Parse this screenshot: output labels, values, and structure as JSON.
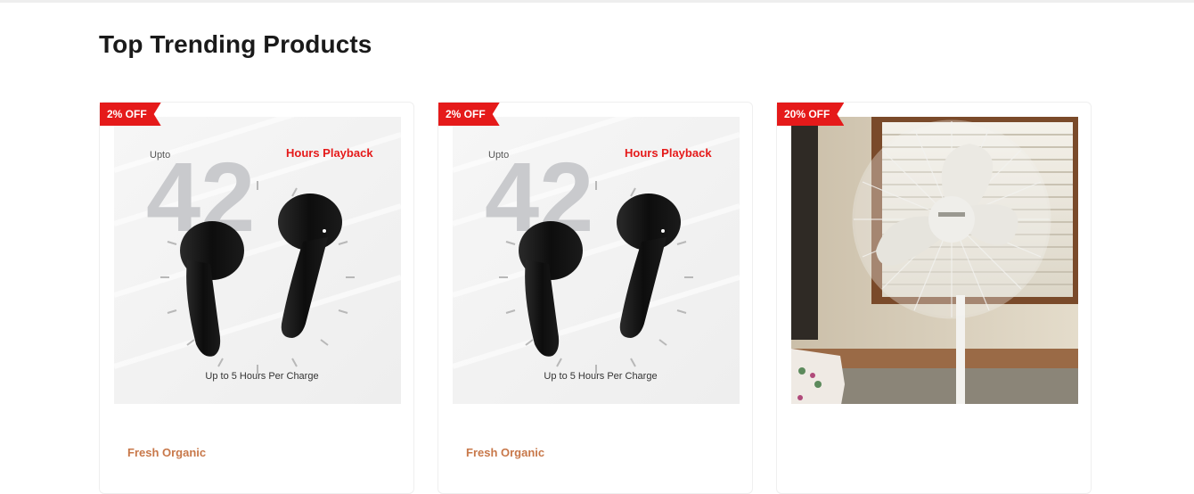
{
  "section": {
    "title": "Top Trending Products"
  },
  "products": [
    {
      "discount": "2% OFF",
      "vendor": "Fresh Organic",
      "image": {
        "upto": "Upto",
        "number": "42",
        "headline": "Hours Playback",
        "caption": "Up to 5 Hours Per Charge"
      }
    },
    {
      "discount": "2% OFF",
      "vendor": "Fresh Organic",
      "image": {
        "upto": "Upto",
        "number": "42",
        "headline": "Hours Playback",
        "caption": "Up to 5 Hours Per Charge"
      }
    },
    {
      "discount": "20% OFF",
      "vendor": ""
    }
  ],
  "colors": {
    "badge": "#e51a1a",
    "vendor": "#c8784a",
    "headline": "#e51a1a"
  },
  "icons": {
    "product_1": "earbuds-image",
    "product_2": "earbuds-image",
    "product_3": "pedestal-fan-image"
  }
}
